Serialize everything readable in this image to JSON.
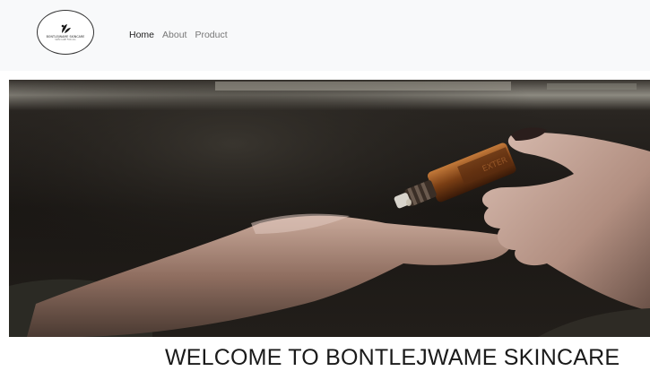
{
  "logo": {
    "text": "BONTLEJWAME SKINCARE",
    "subtext": "SKIN CARE FOR ALL"
  },
  "nav": {
    "items": [
      {
        "label": "Home",
        "active": true
      },
      {
        "label": "About",
        "active": false
      },
      {
        "label": "Product",
        "active": false
      }
    ]
  },
  "hero": {
    "image": "hand-applying-serum-drop-photo",
    "bottle_label": "EXTER"
  },
  "main": {
    "heading": "WELCOME TO BONTLEJWAME SKINCARE"
  },
  "colors": {
    "navbar_bg": "#f8f9fa",
    "active_link": "#222222",
    "inactive_link": "#777777",
    "hero_bg": "#181613"
  }
}
